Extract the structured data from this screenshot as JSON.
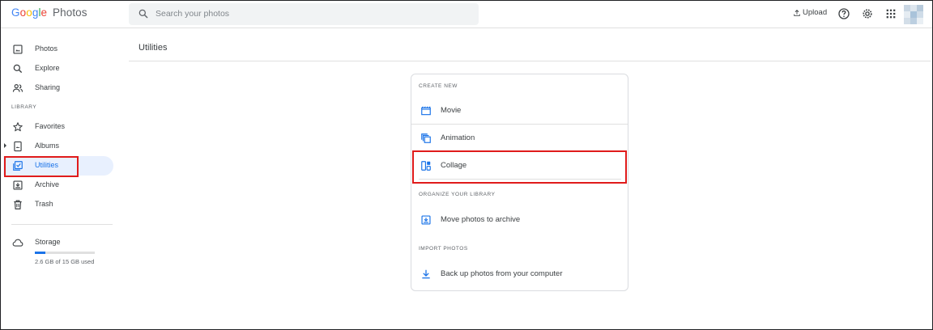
{
  "app": {
    "logo_letters": [
      "G",
      "o",
      "o",
      "g",
      "l",
      "e"
    ],
    "logo_colors": [
      "#4285f4",
      "#ea4335",
      "#fbbc05",
      "#4285f4",
      "#34a853",
      "#ea4335"
    ],
    "logo_product": "Photos"
  },
  "header": {
    "search_placeholder": "Search your photos",
    "upload_label": "Upload",
    "icons": [
      "help-icon",
      "settings-gear-icon",
      "apps-grid-icon",
      "avatar"
    ]
  },
  "sidebar": {
    "items_top": [
      {
        "label": "Photos",
        "icon": "photo-icon"
      },
      {
        "label": "Explore",
        "icon": "search-icon"
      },
      {
        "label": "Sharing",
        "icon": "people-icon"
      }
    ],
    "library_label": "LIBRARY",
    "items_library": [
      {
        "label": "Favorites",
        "icon": "star-icon"
      },
      {
        "label": "Albums",
        "icon": "album-icon"
      },
      {
        "label": "Utilities",
        "icon": "utilities-icon",
        "active": true
      },
      {
        "label": "Archive",
        "icon": "archive-icon"
      },
      {
        "label": "Trash",
        "icon": "trash-icon"
      }
    ],
    "storage": {
      "label": "Storage",
      "used_text": "2.6 GB of 15 GB used",
      "used_fraction": 0.173
    }
  },
  "main": {
    "page_title": "Utilities",
    "card": {
      "sections": [
        {
          "label": "CREATE NEW",
          "items": [
            {
              "label": "Movie",
              "icon": "movie-icon"
            },
            {
              "label": "Animation",
              "icon": "animation-icon"
            },
            {
              "label": "Collage",
              "icon": "collage-icon"
            }
          ]
        },
        {
          "label": "ORGANIZE YOUR LIBRARY",
          "items": [
            {
              "label": "Move photos to archive",
              "icon": "archive-icon"
            }
          ]
        },
        {
          "label": "IMPORT PHOTOS",
          "items": [
            {
              "label": "Back up photos from your computer",
              "icon": "download-icon"
            }
          ]
        }
      ]
    }
  },
  "colors": {
    "accent": "#1a73e8",
    "highlight_box": "#e01b1b",
    "active_bg": "#e8f0fe"
  }
}
